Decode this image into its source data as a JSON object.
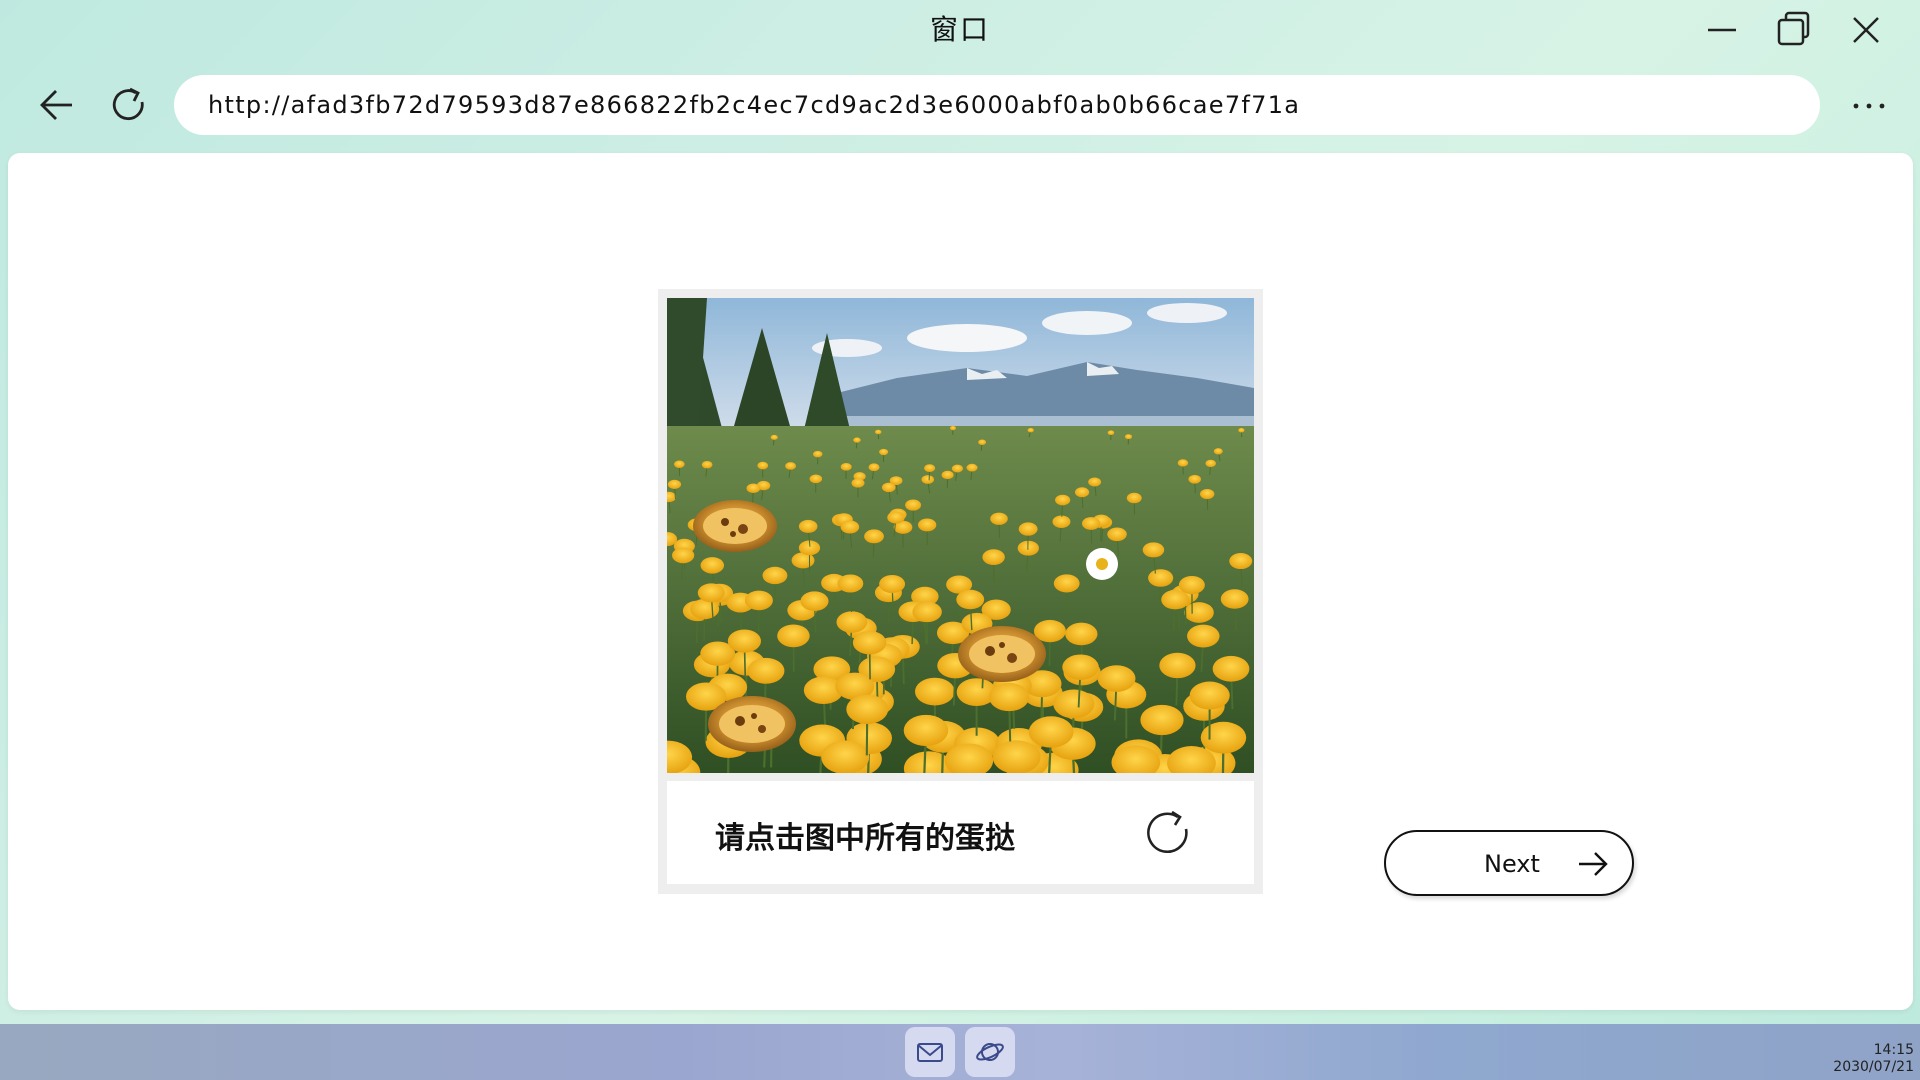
{
  "window": {
    "title": "窗口"
  },
  "browser": {
    "url": "http://afad3fb72d79593d87e866822fb2c4ec7cd9ac2d3e6000abf0ab0b66cae7f71a"
  },
  "captcha": {
    "instruction": "请点击图中所有的蛋挞",
    "image_description_icons": [
      "egg-tart",
      "yellow-flower",
      "daisy"
    ]
  },
  "actions": {
    "next_label": "Next"
  },
  "taskbar": {
    "apps": [
      "mail-icon",
      "browser-planet-icon"
    ],
    "time": "14:15",
    "date": "2030/07/21"
  },
  "colors": {
    "flower_yellow": "#f2b31c",
    "text": "#111111"
  }
}
